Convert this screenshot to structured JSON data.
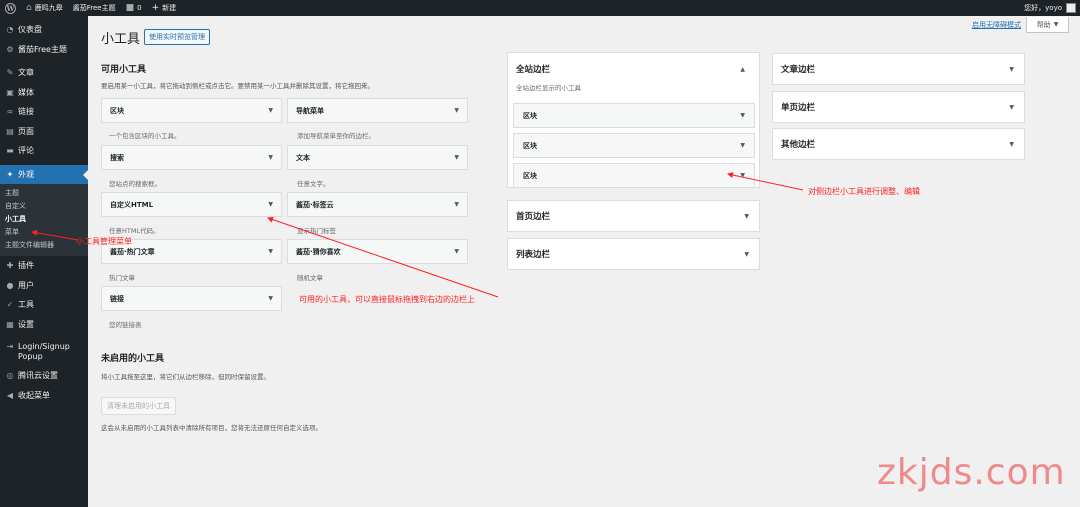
{
  "adminbar": {
    "site_name": "鹿鸣九皋",
    "theme_label": "酱茄Free主题",
    "comments_count": "0",
    "new_label": "新建",
    "greeting": "您好，yoyo"
  },
  "sidebar": {
    "items": [
      {
        "icon": "dashboard",
        "label": "仪表盘"
      },
      {
        "icon": "gear",
        "label": "酱茄Free主题"
      },
      {
        "icon": "pin",
        "label": "文章"
      },
      {
        "icon": "media",
        "label": "媒体"
      },
      {
        "icon": "link",
        "label": "链接"
      },
      {
        "icon": "page",
        "label": "页面"
      },
      {
        "icon": "comment",
        "label": "评论"
      },
      {
        "icon": "brush",
        "label": "外观"
      },
      {
        "icon": "plugin",
        "label": "插件"
      },
      {
        "icon": "user",
        "label": "用户"
      },
      {
        "icon": "wrench",
        "label": "工具"
      },
      {
        "icon": "settings",
        "label": "设置"
      },
      {
        "icon": "login",
        "label": "Login/Signup Popup"
      },
      {
        "icon": "cloud",
        "label": "腾讯云设置"
      },
      {
        "icon": "collapse",
        "label": "收起菜单"
      }
    ],
    "submenu": [
      "主题",
      "自定义",
      "小工具",
      "菜单",
      "主题文件编辑器"
    ]
  },
  "header": {
    "help": "帮助",
    "accessibility": "启用无障碍模式",
    "title": "小工具",
    "live_preview": "使用实时预览管理"
  },
  "available": {
    "title": "可用小工具",
    "desc": "要启用某一小工具，将它拖动到侧栏或点击它。要禁用某一小工具并删除其设置，将它拖回来。",
    "widgets": [
      {
        "name": "区块",
        "desc": "一个包含区块的小工具。"
      },
      {
        "name": "导航菜单",
        "desc": "添加导航菜单至你的边栏。"
      },
      {
        "name": "搜索",
        "desc": "您站点的搜索框。"
      },
      {
        "name": "文本",
        "desc": "任意文字。"
      },
      {
        "name": "自定义HTML",
        "desc": "任意HTML代码。"
      },
      {
        "name": "酱茄·标签云",
        "desc": "显示热门标签"
      },
      {
        "name": "酱茄·热门文章",
        "desc": "热门文章"
      },
      {
        "name": "酱茄·猜你喜欢",
        "desc": "随机文章"
      },
      {
        "name": "链接",
        "desc": "您的链接表"
      }
    ]
  },
  "inactive": {
    "title": "未启用的小工具",
    "desc": "将小工具拖至这里，将它们从边栏移除，但同时保留设置。",
    "clear": "清理未启用的小工具",
    "note": "这会从未启用的小工具列表中清除所有项目，您将无法还原任何自定义选项。"
  },
  "sidebars": {
    "full": {
      "title": "全站边栏",
      "desc": "全站边栏显示的小工具",
      "widgets": [
        "区块",
        "区块",
        "区块"
      ]
    },
    "home": "首页边栏",
    "list": "列表边栏",
    "article": "文章边栏",
    "single": "单页边栏",
    "other": "其他边栏"
  },
  "annotations": {
    "menu": "小工具管理菜单",
    "drag": "可用的小工具，可以直接鼠标拖拽到右边的边栏上",
    "edit": "对侧边栏小工具进行调整、编辑"
  },
  "watermark": "zkjds.com",
  "colors": {
    "admin_dark": "#1d2327",
    "accent": "#2271b1",
    "annotation": "#ff2020"
  }
}
